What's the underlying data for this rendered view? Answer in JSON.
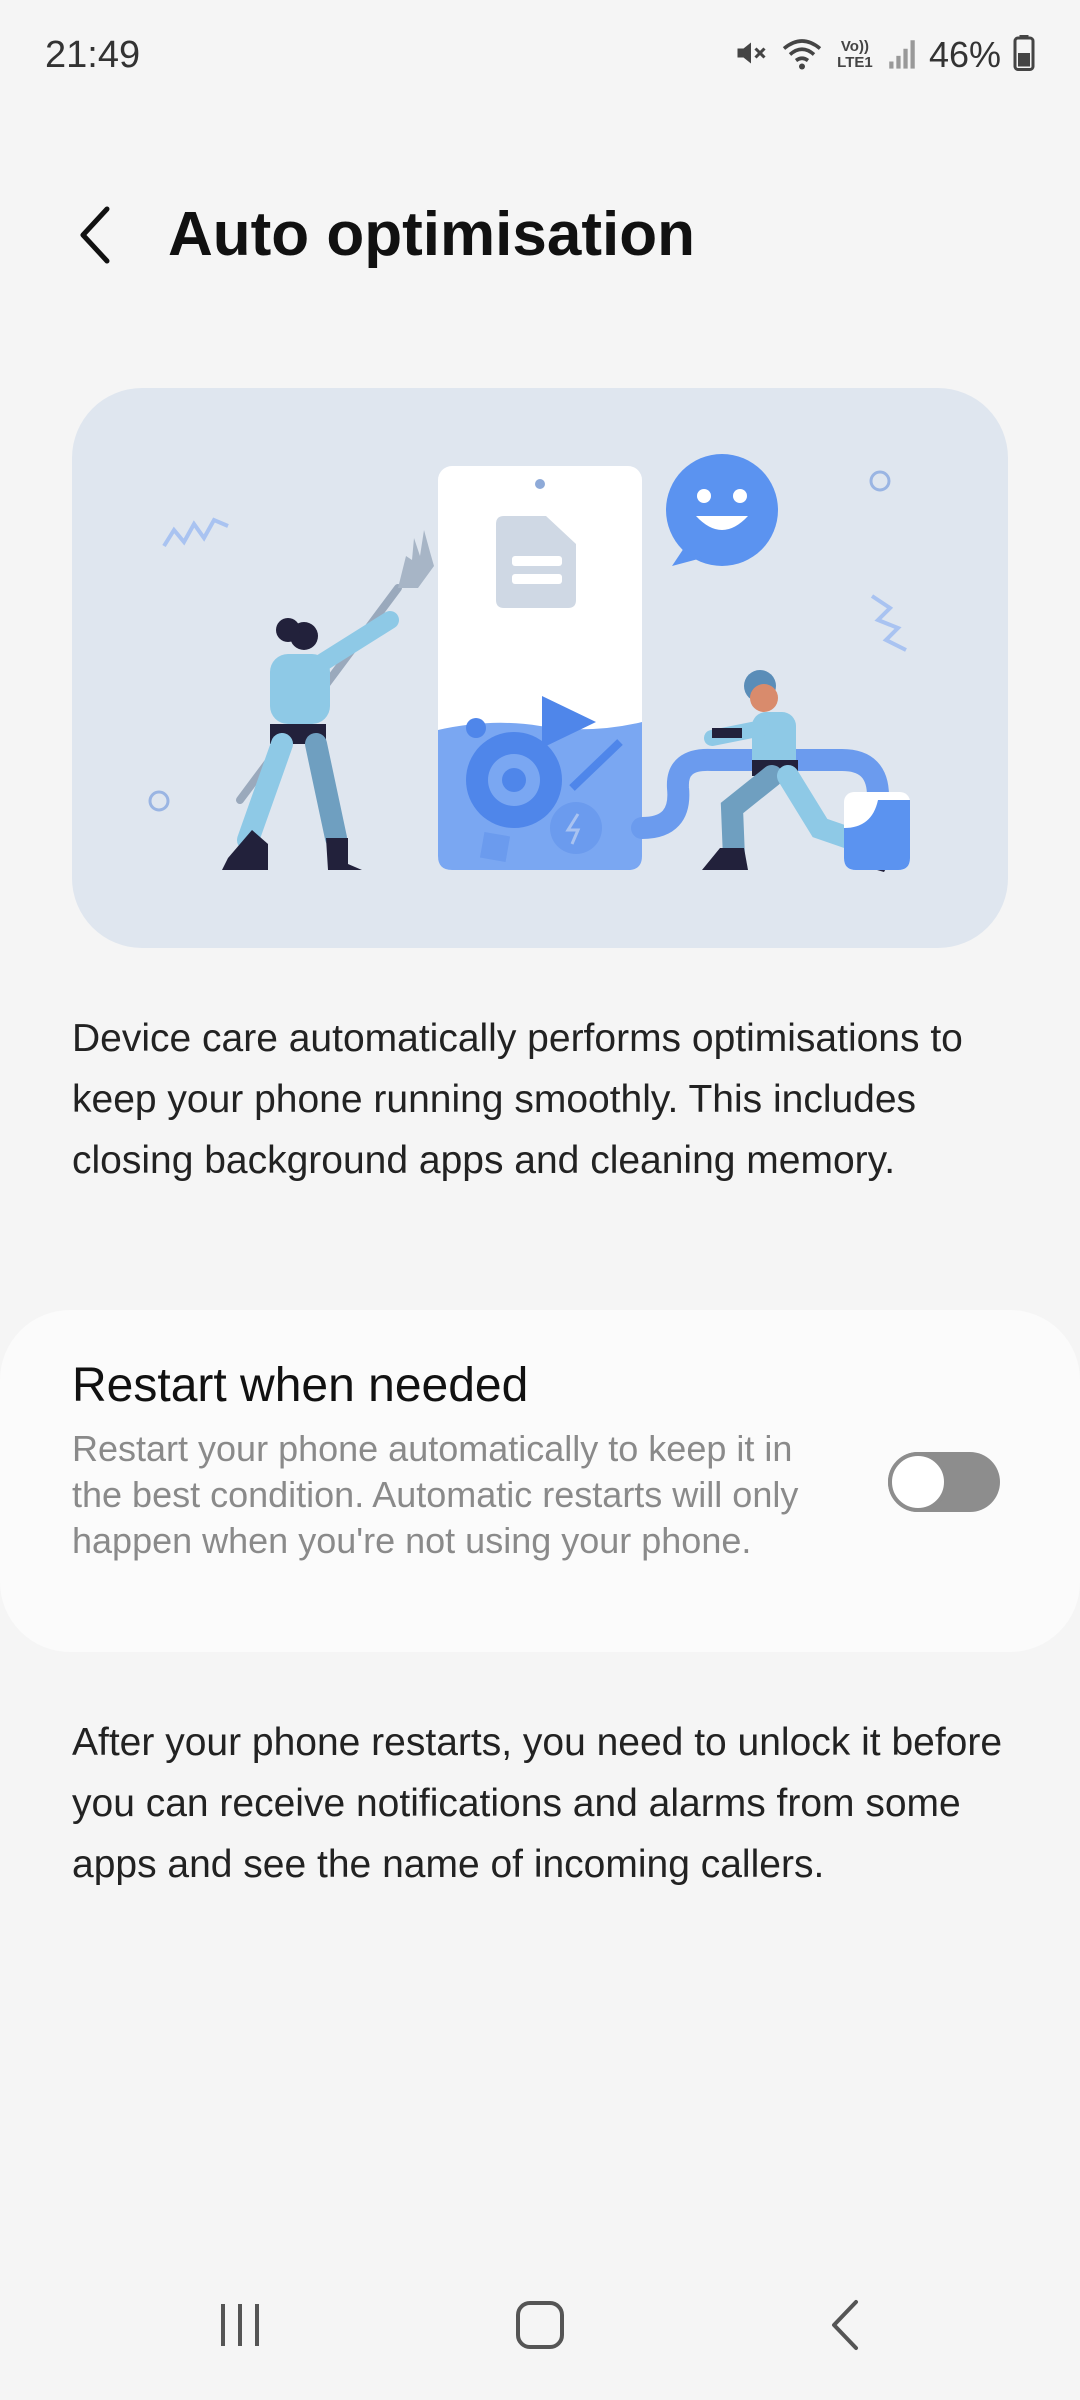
{
  "status_bar": {
    "time": "21:49",
    "battery": "46%",
    "icons": [
      "mute-icon",
      "wifi-icon",
      "volte-lte-icon",
      "signal-icon",
      "battery-icon"
    ],
    "volte_label": "Vo)) LTE1"
  },
  "header": {
    "title": "Auto optimisation",
    "back_icon": "chevron-left-icon"
  },
  "description": "Device care automatically performs optimisations to keep your phone running smoothly. This includes closing background apps and cleaning memory.",
  "restart_card": {
    "title": "Restart when needed",
    "subtitle": "Restart your phone automatically to keep it in the best condition. Automatic restarts will only happen when you're not using your phone.",
    "toggle_on": false
  },
  "note": "After your phone restarts, you need to unlock it before you can receive notifications and alarms from some apps and see the name of incoming callers.",
  "navbar": {
    "icons": [
      "recent-apps-icon",
      "home-icon",
      "back-icon"
    ]
  },
  "colors": {
    "background": "#f5f5f5",
    "illustration_bg": "#dfe6ef",
    "accent_blue": "#5b93f0",
    "toggle_off": "#8d8d8d",
    "subtitle_gray": "#8a8a8a"
  }
}
